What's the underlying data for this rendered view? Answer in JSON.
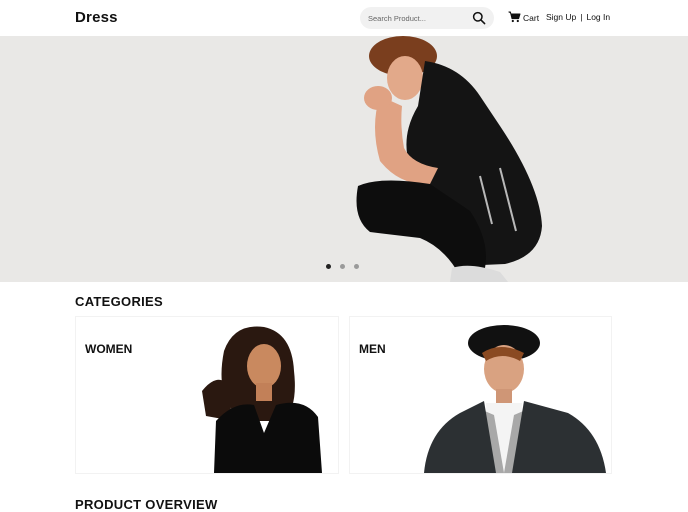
{
  "header": {
    "logo": "Dress",
    "search": {
      "placeholder": "Search Product..."
    },
    "cart_label": "Cart",
    "sign_up": "Sign Up",
    "separator": "|",
    "log_in": "Log In"
  },
  "hero": {
    "slides_count": 3,
    "active_slide": 1
  },
  "categories": {
    "title": "CATEGORIES",
    "items": [
      {
        "label": "WOMEN"
      },
      {
        "label": "MEN"
      }
    ]
  },
  "product_overview": {
    "title": "PRODUCT OVERVIEW"
  },
  "colors": {
    "hero_bg": "#e9e8e6",
    "search_bg": "#f1f1f1",
    "text": "#111111"
  }
}
